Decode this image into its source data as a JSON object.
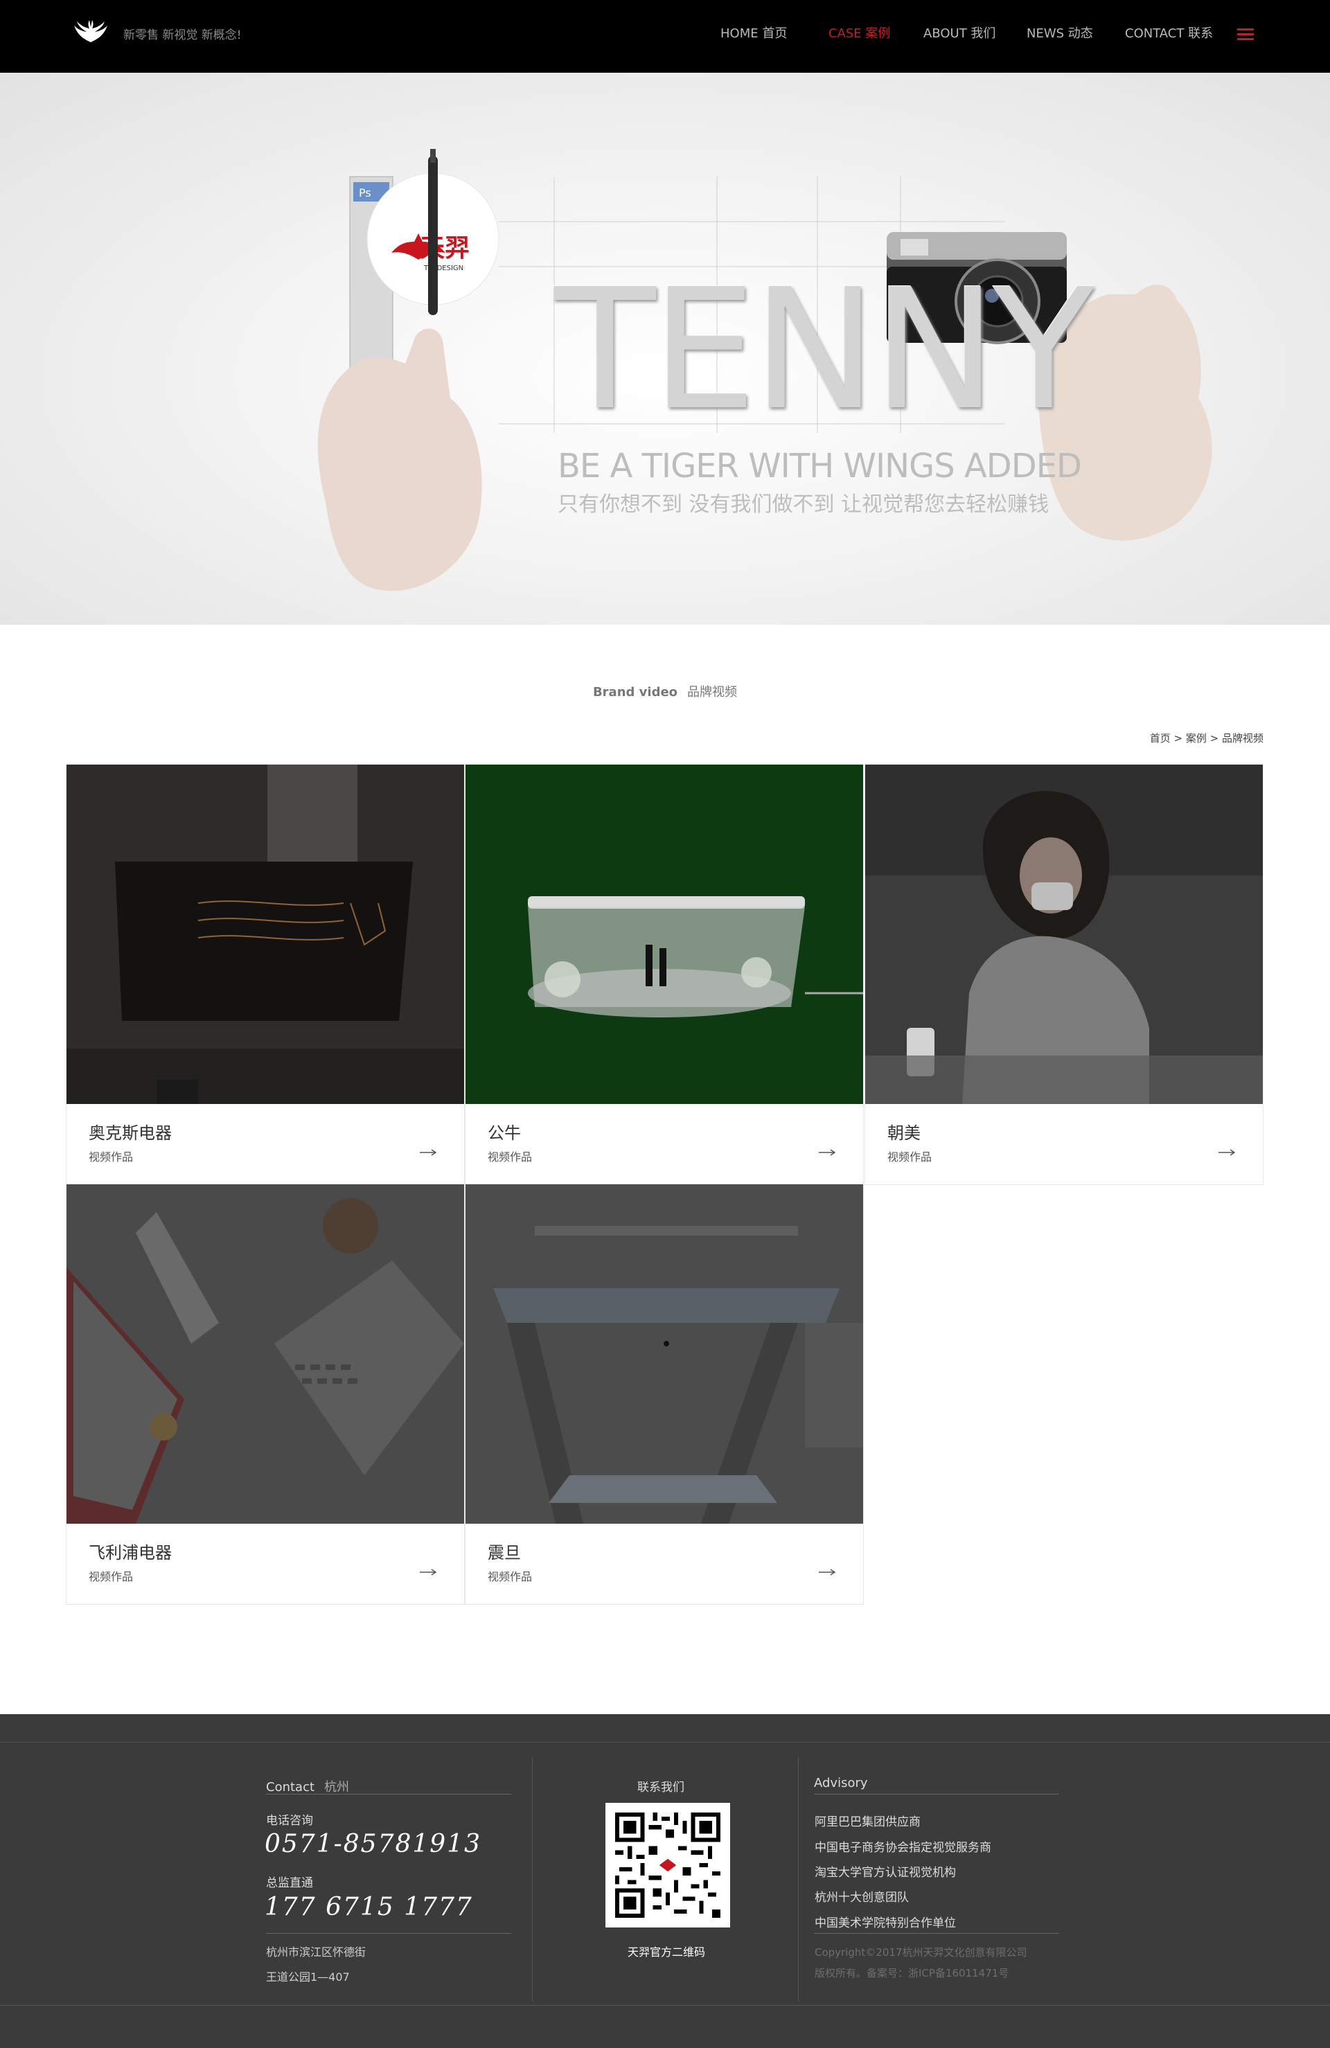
{
  "header": {
    "slogan": "新零售 新视觉 新概念!",
    "nav": [
      {
        "label": "HOME 首页",
        "active": false
      },
      {
        "label": "CASE 案例",
        "active": true
      },
      {
        "label": "ABOUT 我们",
        "active": false
      },
      {
        "label": "NEWS 动态",
        "active": false
      },
      {
        "label": "CONTACT 联系",
        "active": false
      }
    ],
    "accent_color": "#c0202b"
  },
  "banner": {
    "headline": "TENNY",
    "tagline_en": "BE A TIGER WITH WINGS ADDED",
    "tagline_cn": "只有你想不到 没有我们做不到 让视觉帮您去轻松赚钱",
    "badge_brand": "天羿",
    "badge_sub": "T·Y·DESIGN"
  },
  "section": {
    "title_en": "Brand video",
    "title_cn": "品牌视频"
  },
  "breadcrumb": [
    "首页",
    "案例",
    "品牌视频"
  ],
  "cases": [
    {
      "title": "奥克斯电器",
      "subtitle": "视频作品"
    },
    {
      "title": "公牛",
      "subtitle": "视频作品"
    },
    {
      "title": "朝美",
      "subtitle": "视频作品"
    },
    {
      "title": "飞利浦电器",
      "subtitle": "视频作品"
    },
    {
      "title": "震旦",
      "subtitle": "视频作品"
    }
  ],
  "footer": {
    "contact_label": "Contact",
    "contact_city": "杭州",
    "phone_label": "电话咨询",
    "phone": "0571-85781913",
    "director_label": "总监直通",
    "director_phone": "177 6715 1777",
    "address_line1": "杭州市滨江区怀德街",
    "address_line2": "王道公园1—407",
    "qr_title": "联系我们",
    "qr_caption": "天羿官方二维码",
    "advisory_title": "Advisory",
    "advisory_items": [
      "阿里巴巴集团供应商",
      "中国电子商务协会指定视觉服务商",
      "淘宝大学官方认证视觉机构",
      "杭州十大创意团队",
      "中国美术学院特别合作单位"
    ],
    "copyright_line1": "Copyright©2017杭州天羿文化创意有限公司",
    "copyright_line2": "版权所有。备案号：浙ICP备16011471号"
  }
}
